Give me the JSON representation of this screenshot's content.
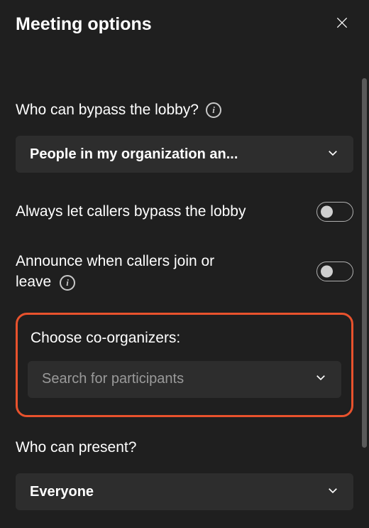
{
  "header": {
    "title": "Meeting options"
  },
  "options": {
    "bypass_lobby": {
      "label": "Who can bypass the lobby?",
      "value": "People in my organization an..."
    },
    "callers_bypass": {
      "label": "Always let callers bypass the lobby",
      "enabled": false
    },
    "announce": {
      "label": "Announce when callers join or leave",
      "enabled": false
    },
    "co_organizers": {
      "label": "Choose co-organizers:",
      "placeholder": "Search for participants"
    },
    "present": {
      "label": "Who can present?",
      "value": "Everyone"
    }
  }
}
